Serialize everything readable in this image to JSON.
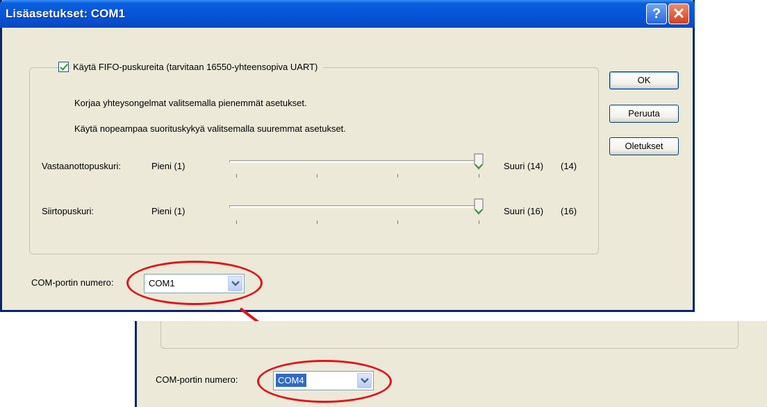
{
  "dialog": {
    "title": "Lisäasetukset: COM1",
    "help_label": "?",
    "close_label": "✕"
  },
  "fifo": {
    "checkbox_label": "Käytä FIFO-puskureita (tarvitaan 16550-yhteensopiva UART)",
    "checked": true,
    "hint_low": "Korjaa yhteysongelmat valitsemalla pienemmät asetukset.",
    "hint_high": "Käytä nopeampaa suorituskykyä valitsemalla suuremmat asetukset."
  },
  "receive_buffer": {
    "label": "Vastaanottopuskuri:",
    "min_label": "Pieni (1)",
    "max_label": "Suuri (14)",
    "value_label": "(14)",
    "value": 14,
    "max": 14
  },
  "transmit_buffer": {
    "label": "Siirtopuskuri:",
    "min_label": "Pieni (1)",
    "max_label": "Suuri (16)",
    "value_label": "(16)",
    "value": 16,
    "max": 16
  },
  "buttons": {
    "ok": "OK",
    "cancel": "Peruuta",
    "defaults": "Oletukset"
  },
  "com_port": {
    "label": "COM-portin numero:",
    "value": "COM1"
  },
  "com_port_after": {
    "label": "COM-portin numero:",
    "value": "COM4"
  },
  "colors": {
    "annotation": "#e3121b",
    "selection": "#316ac5"
  },
  "icons": [
    "help-icon",
    "close-icon",
    "checkmark-icon",
    "slider-thumb-icon",
    "chevron-down-icon",
    "arrow-icon"
  ]
}
